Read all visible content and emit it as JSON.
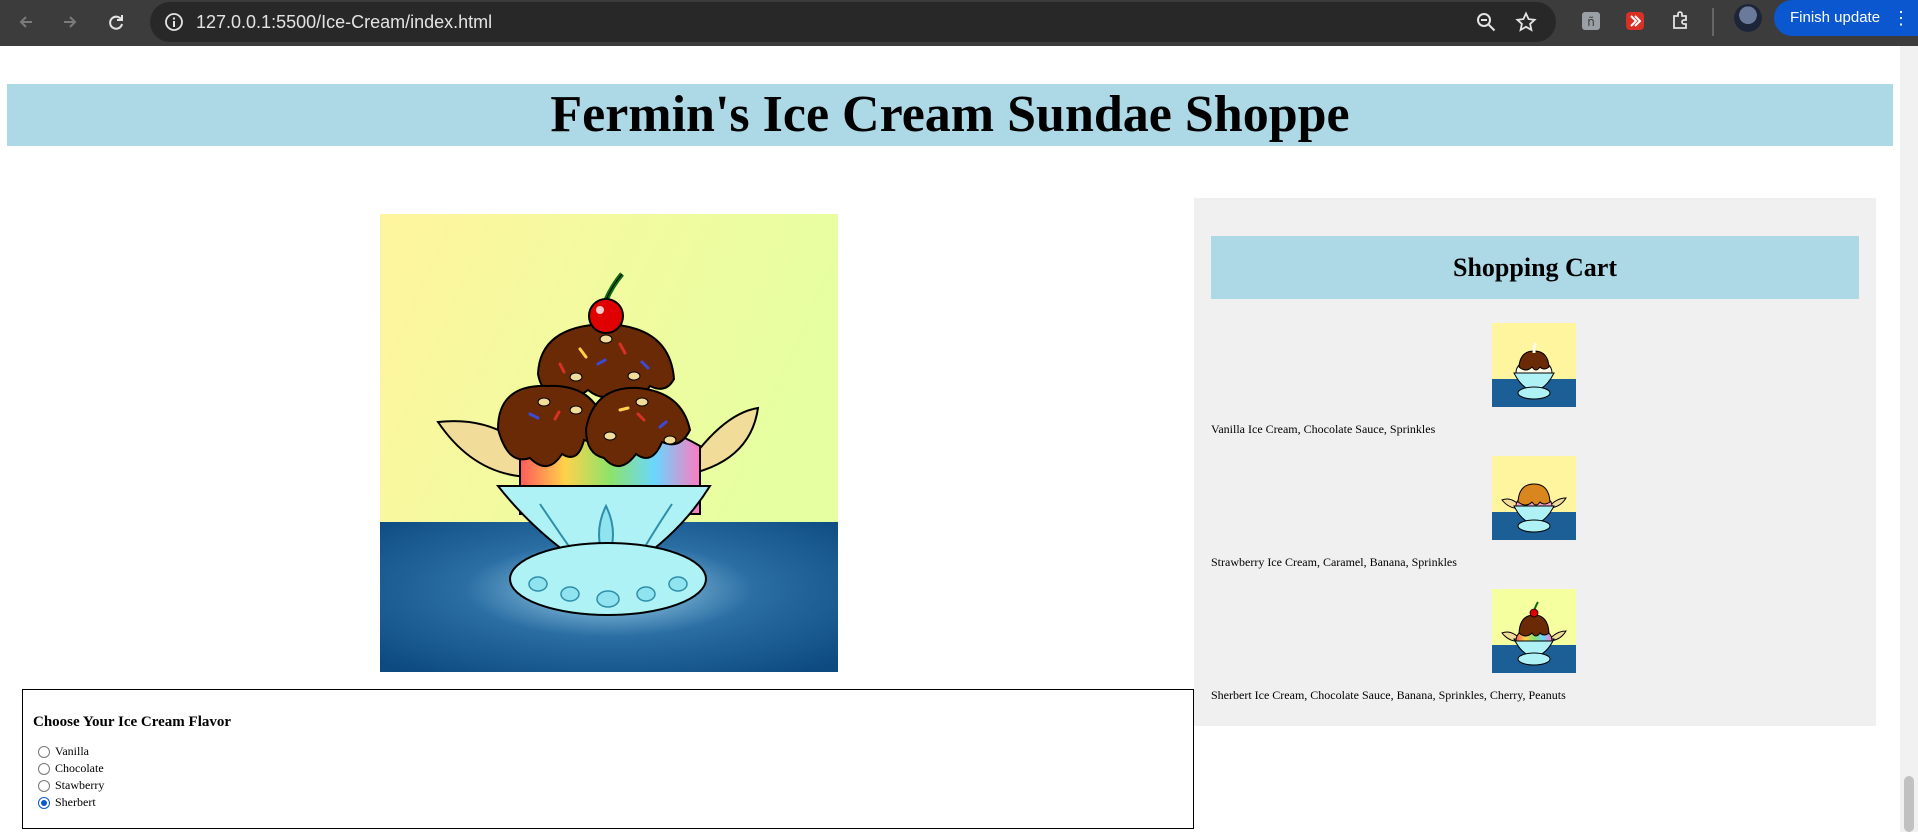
{
  "browser": {
    "url": "127.0.0.1:5500/Ice-Cream/index.html",
    "update_label": "Finish update",
    "menu_glyph": "⋮"
  },
  "page": {
    "title": "Fermin's Ice Cream Sundae Shoppe",
    "flavor_heading": "Choose Your Ice Cream Flavor",
    "flavors": [
      {
        "label": "Vanilla",
        "checked": false
      },
      {
        "label": "Chocolate",
        "checked": false
      },
      {
        "label": "Stawberry",
        "checked": false
      },
      {
        "label": "Sherbert",
        "checked": true
      }
    ]
  },
  "cart": {
    "title": "Shopping Cart",
    "items": [
      {
        "description": "Vanilla Ice Cream, Chocolate Sauce, Sprinkles"
      },
      {
        "description": "Strawberry Ice Cream, Caramel, Banana, Sprinkles"
      },
      {
        "description": "Sherbert Ice Cream, Chocolate Sauce, Banana, Sprinkles, Cherry, Peanuts"
      }
    ]
  },
  "colors": {
    "header_bg": "#add8e6",
    "cart_bg": "#f0f0f0",
    "chrome_bg": "#3c3c3c",
    "update_button": "#0b57d0"
  },
  "icons": [
    "back-arrow-icon",
    "forward-arrow-icon",
    "reload-icon",
    "site-info-icon",
    "zoom-icon",
    "bookmark-star-icon",
    "extension-icon",
    "puzzle-icon",
    "profile-avatar"
  ]
}
